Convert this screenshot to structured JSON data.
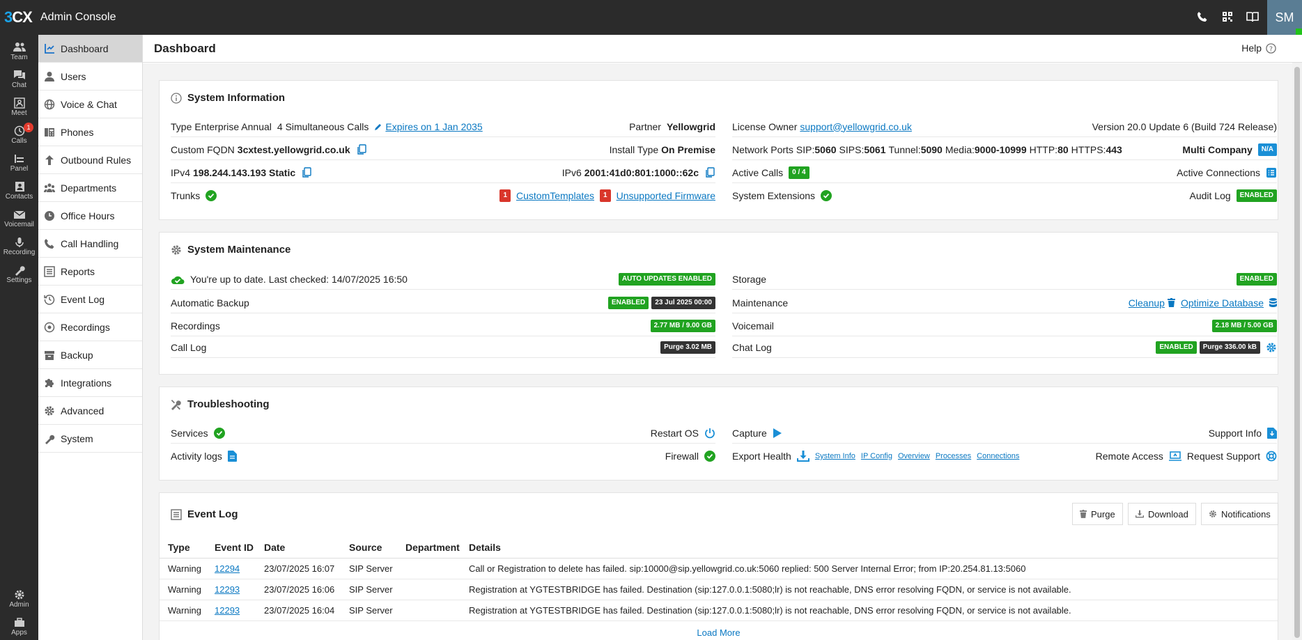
{
  "app": {
    "logo_num": "3",
    "logo_text": "CX",
    "title": "Admin Console",
    "avatar": "SM"
  },
  "rail": {
    "items": [
      {
        "label": "Team",
        "icon": "team-icon"
      },
      {
        "label": "Chat",
        "icon": "chat-icon"
      },
      {
        "label": "Meet",
        "icon": "meet-icon"
      },
      {
        "label": "Calls",
        "icon": "calls-icon",
        "badge": "1"
      },
      {
        "label": "Panel",
        "icon": "panel-icon"
      },
      {
        "label": "Contacts",
        "icon": "contacts-icon"
      },
      {
        "label": "Voicemail",
        "icon": "voicemail-icon"
      },
      {
        "label": "Recording",
        "icon": "recording-icon"
      },
      {
        "label": "Settings",
        "icon": "settings-icon"
      }
    ],
    "admin": "Admin",
    "apps": "Apps"
  },
  "sidebar": {
    "items": [
      {
        "label": "Dashboard"
      },
      {
        "label": "Users"
      },
      {
        "label": "Voice & Chat"
      },
      {
        "label": "Phones"
      },
      {
        "label": "Outbound Rules"
      },
      {
        "label": "Departments"
      },
      {
        "label": "Office Hours"
      },
      {
        "label": "Call Handling"
      },
      {
        "label": "Reports"
      },
      {
        "label": "Event Log"
      },
      {
        "label": "Recordings"
      },
      {
        "label": "Backup"
      },
      {
        "label": "Integrations"
      },
      {
        "label": "Advanced"
      },
      {
        "label": "System"
      }
    ]
  },
  "page": {
    "title": "Dashboard",
    "help": "Help"
  },
  "sysinfo": {
    "title": "System Information",
    "type_label": "Type",
    "type_value": "Enterprise Annual",
    "calls": "4 Simultaneous Calls",
    "expires": "Expires on 1 Jan 2035",
    "partner_label": "Partner",
    "partner_value": "Yellowgrid",
    "owner_label": "License Owner",
    "owner_email": "support@yellowgrid.co.uk",
    "version": "Version 20.0 Update 6 (Build 724 Release)",
    "fqdn_label": "Custom FQDN",
    "fqdn_value": "3cxtest.yellowgrid.co.uk",
    "install_label": "Install Type",
    "install_value": "On Premise",
    "ports_label": "Network Ports",
    "sip_label": "SIP:",
    "sip": "5060",
    "sips_label": "SIPS:",
    "sips": "5061",
    "tunnel_label": "Tunnel:",
    "tunnel": "5090",
    "media_label": "Media:",
    "media": "9000-10999",
    "http_label": "HTTP:",
    "http": "80",
    "https_label": "HTTPS:",
    "https": "443",
    "multi_label": "Multi Company",
    "multi_badge": "N/A",
    "ipv4_label": "IPv4",
    "ipv4_value": "198.244.143.193 Static",
    "ipv6_label": "IPv6",
    "ipv6_value": "2001:41d0:801:1000::62c",
    "active_calls_label": "Active Calls",
    "active_calls_badge": "0 / 4",
    "active_conn_label": "Active Connections",
    "trunks_label": "Trunks",
    "ct_count": "1",
    "ct_label": "CustomTemplates",
    "uf_count": "1",
    "uf_label": "Unsupported Firmware",
    "ext_label": "System Extensions",
    "audit_label": "Audit Log",
    "audit_badge": "ENABLED"
  },
  "maintenance": {
    "title": "System Maintenance",
    "uptodate": "You're up to date. Last checked: 14/07/2025 16:50",
    "auto_updates": "AUTO UPDATES ENABLED",
    "storage_label": "Storage",
    "storage_badge": "ENABLED",
    "backup_label": "Automatic Backup",
    "backup_badge": "ENABLED",
    "backup_date": "23 Jul 2025 00:00",
    "maint_label": "Maintenance",
    "cleanup": "Cleanup",
    "optimize": "Optimize Database",
    "recordings_label": "Recordings",
    "recordings_badge": "2.77 MB / 9.00 GB",
    "voicemail_label": "Voicemail",
    "voicemail_badge": "2.18 MB / 5.00 GB",
    "calllog_label": "Call Log",
    "calllog_badge": "Purge 3.02 MB",
    "chatlog_label": "Chat Log",
    "chatlog_enabled": "ENABLED",
    "chatlog_purge": "Purge 336.00 kB"
  },
  "troubleshooting": {
    "title": "Troubleshooting",
    "services": "Services",
    "restart": "Restart OS",
    "capture": "Capture",
    "support_info": "Support Info",
    "activity": "Activity logs",
    "firewall": "Firewall",
    "export": "Export Health",
    "links": [
      "System Info",
      "IP Config",
      "Overview",
      "Processes",
      "Connections"
    ],
    "remote": "Remote Access",
    "request": "Request Support"
  },
  "eventlog": {
    "title": "Event Log",
    "purge": "Purge",
    "download": "Download",
    "notifications": "Notifications",
    "columns": [
      "Type",
      "Event ID",
      "Date",
      "Source",
      "Department",
      "Details"
    ],
    "rows": [
      {
        "type": "Warning",
        "id": "12294",
        "date": "23/07/2025 16:07",
        "source": "SIP Server",
        "dept": "",
        "details": "Call or Registration to delete has failed. sip:10000@sip.yellowgrid.co.uk:5060 replied: 500 Server Internal Error; from IP:20.254.81.13:5060"
      },
      {
        "type": "Warning",
        "id": "12293",
        "date": "23/07/2025 16:06",
        "source": "SIP Server",
        "dept": "",
        "details": "Registration at YGTESTBRIDGE has failed. Destination (sip:127.0.0.1:5080;lr) is not reachable, DNS error resolving FQDN, or service is not available."
      },
      {
        "type": "Warning",
        "id": "12293",
        "date": "23/07/2025 16:04",
        "source": "SIP Server",
        "dept": "",
        "details": "Registration at YGTESTBRIDGE has failed. Destination (sip:127.0.0.1:5080;lr) is not reachable, DNS error resolving FQDN, or service is not available."
      }
    ],
    "load_more": "Load More"
  }
}
